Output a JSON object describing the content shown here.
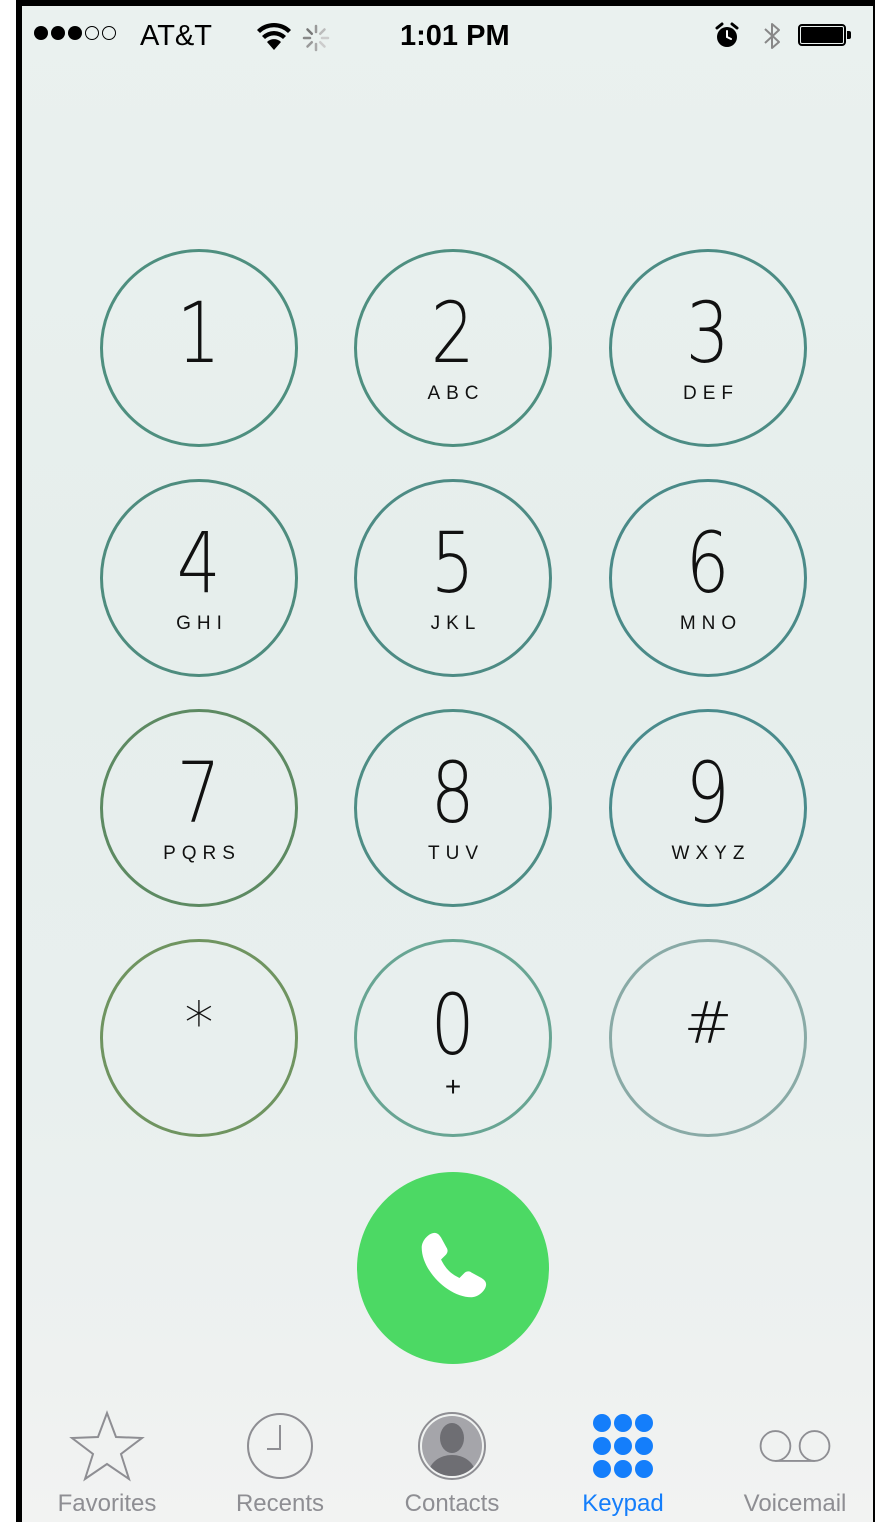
{
  "status_bar": {
    "carrier": "AT&T",
    "time": "1:01 PM",
    "signal_bars_filled": 3,
    "signal_bars_total": 5,
    "icons": [
      "wifi-icon",
      "activity-spinner-icon",
      "alarm-icon",
      "bluetooth-icon",
      "battery-icon"
    ]
  },
  "keypad": {
    "keys": [
      {
        "digit": "1",
        "letters": ""
      },
      {
        "digit": "2",
        "letters": "ABC"
      },
      {
        "digit": "3",
        "letters": "DEF"
      },
      {
        "digit": "4",
        "letters": "GHI"
      },
      {
        "digit": "5",
        "letters": "JKL"
      },
      {
        "digit": "6",
        "letters": "MNO"
      },
      {
        "digit": "7",
        "letters": "PQRS"
      },
      {
        "digit": "8",
        "letters": "TUV"
      },
      {
        "digit": "9",
        "letters": "WXYZ"
      },
      {
        "digit": "*",
        "letters": ""
      },
      {
        "digit": "0",
        "letters": "+"
      },
      {
        "digit": "#",
        "letters": ""
      }
    ]
  },
  "call_button": {
    "icon": "phone-icon",
    "color": "#4cd964"
  },
  "tab_bar": {
    "tabs": [
      {
        "label": "Favorites",
        "icon": "star-icon"
      },
      {
        "label": "Recents",
        "icon": "clock-icon"
      },
      {
        "label": "Contacts",
        "icon": "contact-silhouette-icon"
      },
      {
        "label": "Keypad",
        "icon": "keypad-grid-icon",
        "active": true
      },
      {
        "label": "Voicemail",
        "icon": "voicemail-icon"
      }
    ],
    "active_color": "#147efb",
    "inactive_color": "#8e8e93"
  }
}
